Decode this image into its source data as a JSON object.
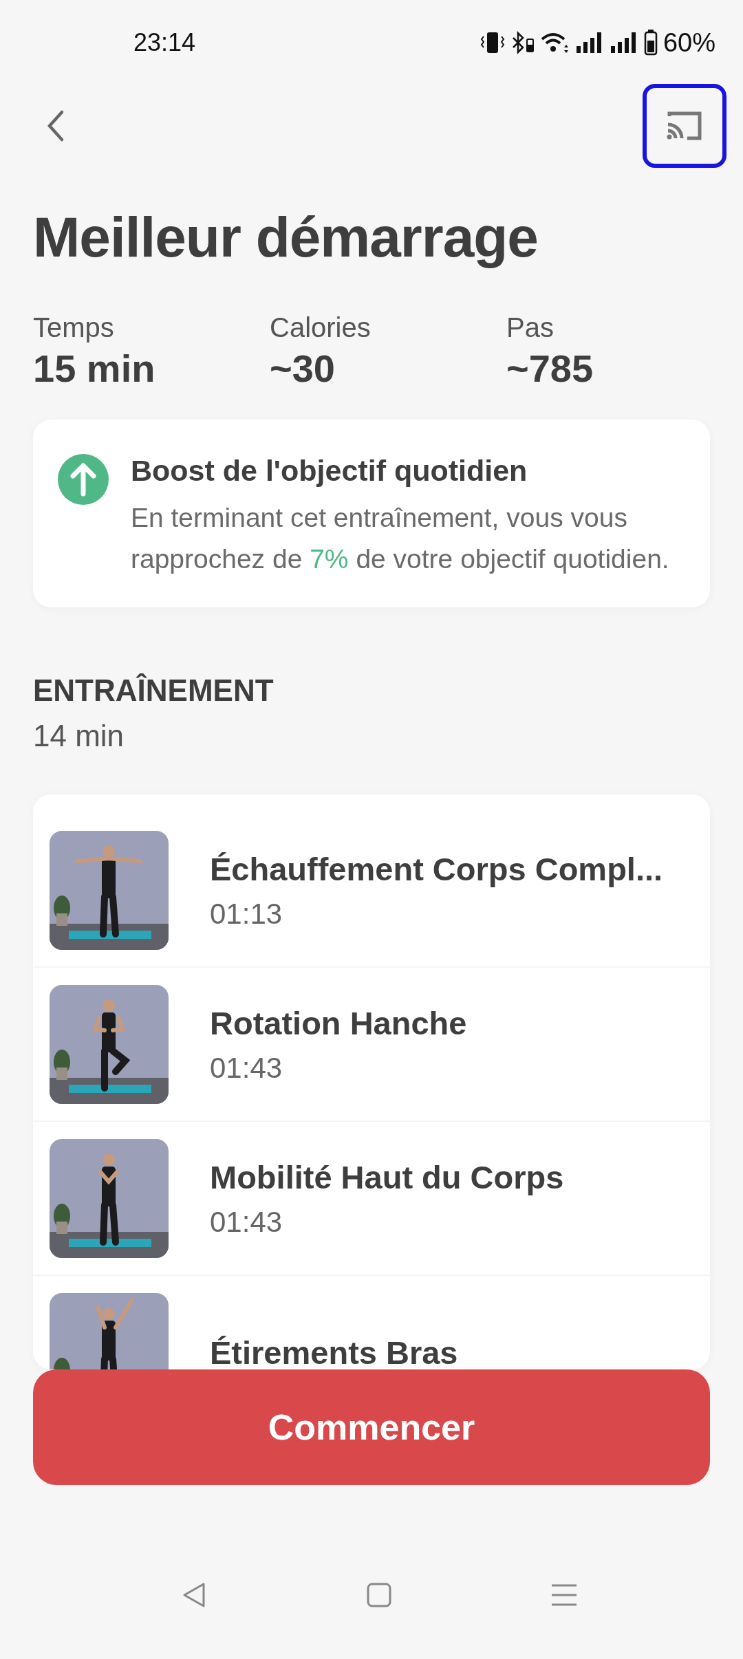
{
  "status_bar": {
    "time": "23:14",
    "battery": "60%"
  },
  "header": {
    "cast_button": {
      "focused": true
    }
  },
  "title": "Meilleur démarrage",
  "stats": [
    {
      "label": "Temps",
      "value": "15 min"
    },
    {
      "label": "Calories",
      "value": "~30"
    },
    {
      "label": "Pas",
      "value": "~785"
    }
  ],
  "boost_card": {
    "title": "Boost de l'objectif quotidien",
    "text": "En terminant cet entraînement, vous vous rapprochez de **7%** de votre objectif quotidien."
  },
  "section": {
    "heading": "ENTRAÎNEMENT",
    "duration": "14 min"
  },
  "exercises": [
    {
      "name": "Échauffement Corps Compl...",
      "duration": "01:13"
    },
    {
      "name": "Rotation Hanche",
      "duration": "01:43"
    },
    {
      "name": "Mobilité Haut du Corps",
      "duration": "01:43"
    },
    {
      "name": "Étirements Bras"
    }
  ],
  "start_button": "Commencer"
}
